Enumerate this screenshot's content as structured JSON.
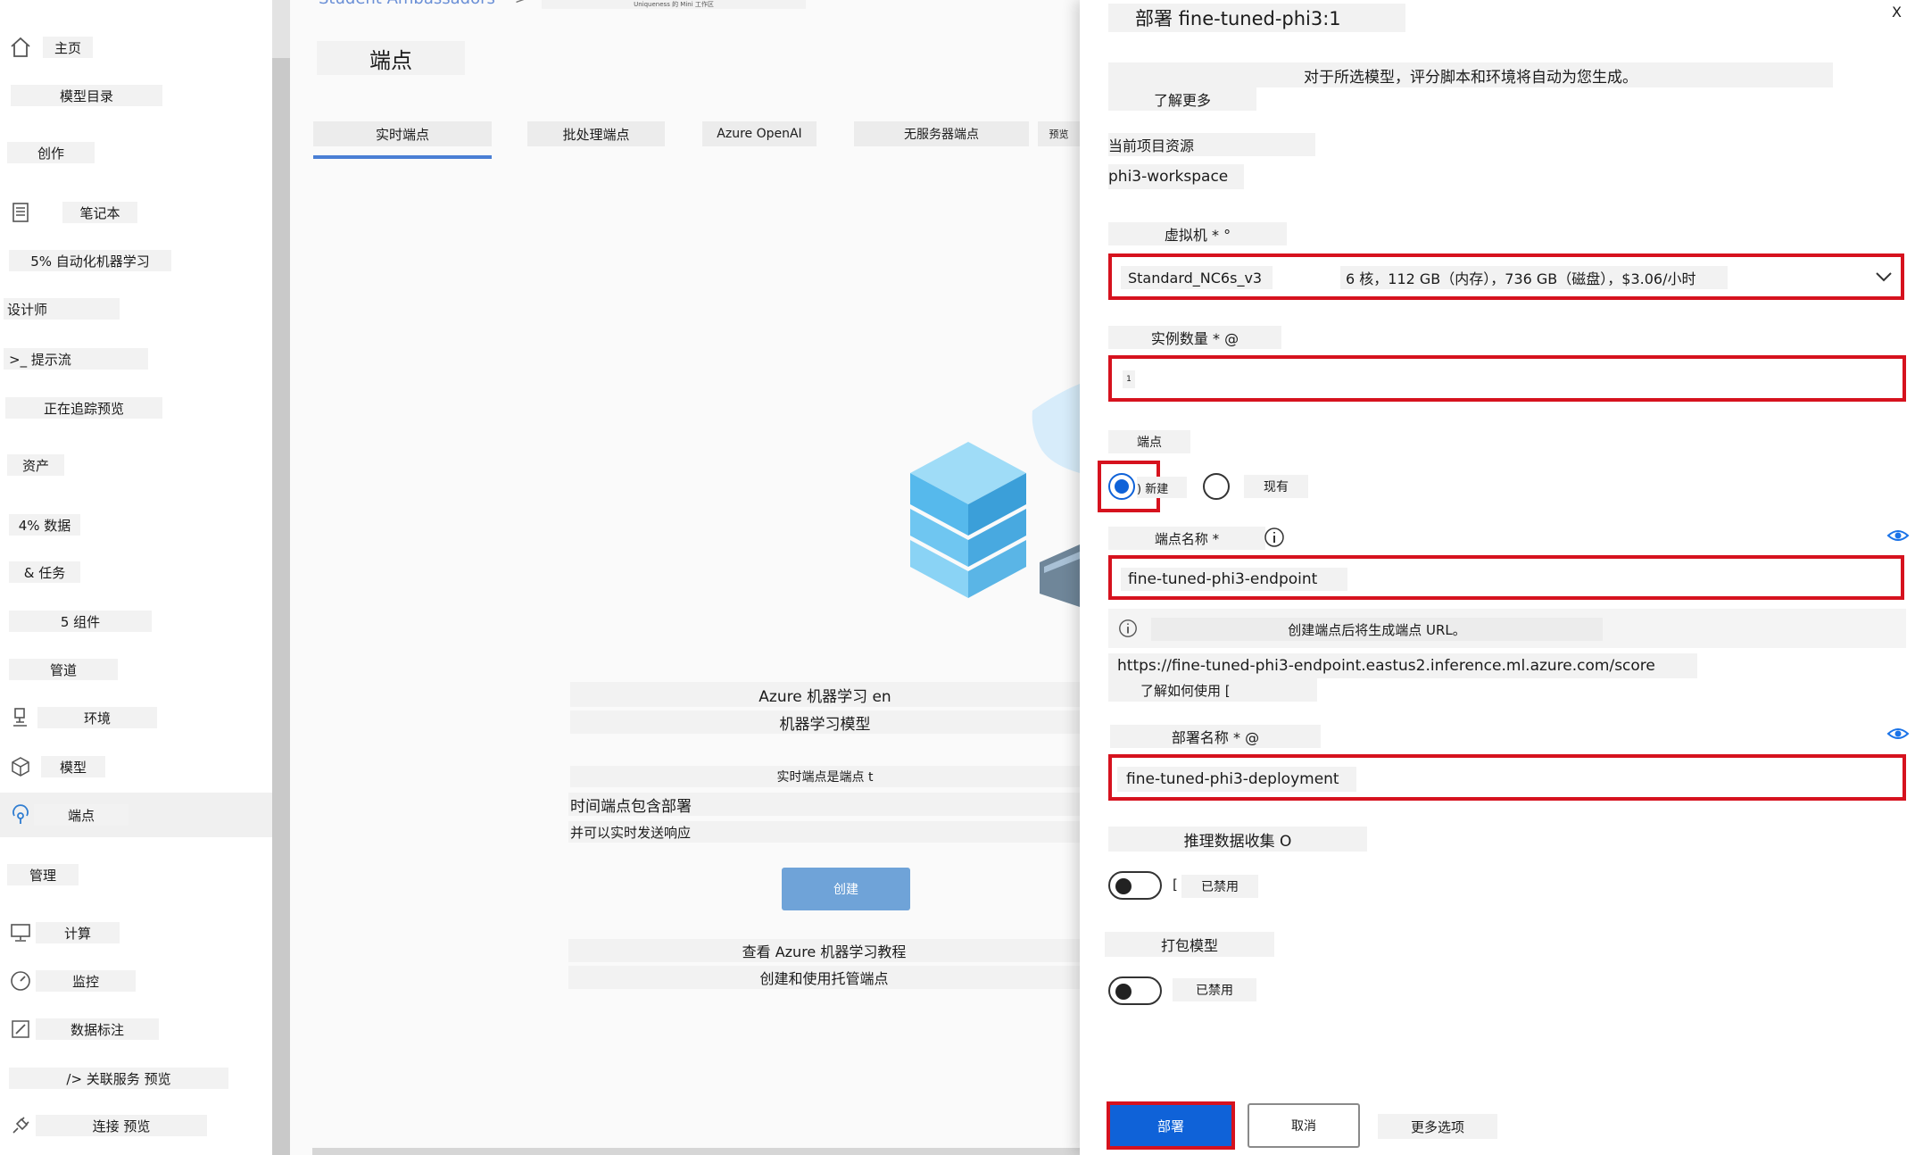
{
  "sidebar": {
    "items": [
      {
        "label": "主页",
        "icon": "home-icon"
      },
      {
        "label": "模型目录",
        "icon": ""
      },
      {
        "label": "创作",
        "icon": ""
      },
      {
        "label": "笔记本",
        "icon": "notebook-icon"
      },
      {
        "label": "5% 自动化机器学习",
        "icon": ""
      },
      {
        "label": "设计师",
        "icon": ""
      },
      {
        "label": ">_ 提示流",
        "icon": ""
      },
      {
        "label": "正在追踪预览",
        "icon": ""
      },
      {
        "label": "资产",
        "icon": ""
      },
      {
        "label": "4% 数据",
        "icon": ""
      },
      {
        "label": "& 任务",
        "icon": ""
      },
      {
        "label": "5 组件",
        "icon": ""
      },
      {
        "label": "管道",
        "icon": ""
      },
      {
        "label": "环境",
        "icon": "environment-icon"
      },
      {
        "label": "模型",
        "icon": "cube-icon"
      },
      {
        "label": "端点",
        "icon": "endpoint-icon"
      },
      {
        "label": "管理",
        "icon": ""
      },
      {
        "label": "计算",
        "icon": "monitor-icon"
      },
      {
        "label": "监控",
        "icon": "gauge-icon"
      },
      {
        "label": "数据标注",
        "icon": "edit-icon"
      },
      {
        "label": "/> 关联服务 预览",
        "icon": ""
      },
      {
        "label": "连接 预览",
        "icon": "plug-icon"
      }
    ]
  },
  "main": {
    "breadcrumb": "Student Ambassadors",
    "breadcrumb_sep": ">",
    "breadcrumb_tail": "Uniqueness 的 Mini 工作区",
    "title": "端点",
    "tabs": [
      "实时端点",
      "批处理端点",
      "Azure OpenAI",
      "无服务器端点",
      "预览"
    ],
    "empty": {
      "heading_1": "Azure 机器学习 en",
      "heading_2": "机器学习模型",
      "desc_1": "实时端点是端点 t",
      "desc_2": "时间端点包含部署",
      "desc_3": "并可以实时发送响应",
      "create_label": "创建",
      "link_1": "查看 Azure 机器学习教程",
      "link_2": "创建和使用托管端点"
    }
  },
  "panel": {
    "title": "部署 fine-tuned-phi3:1",
    "close": "X",
    "intro": "对于所选模型，评分脚本和环境将自动为您生成。",
    "learn_more": "了解更多",
    "current_resource_label": "当前项目资源",
    "current_resource_value": "phi3-workspace",
    "vm_label": "虚拟机 * °",
    "vm_name": "Standard_NC6s_v3",
    "vm_spec": "6 核，112 GB（内存），736 GB（磁盘），$3.06/小时",
    "instance_label": "实例数量 * @",
    "instance_value": "1",
    "endpoint_label": "端点",
    "endpoint_new": ") 新建",
    "endpoint_existing": "现有",
    "endpoint_name_label": "端点名称 *",
    "endpoint_name_value": "fine-tuned-phi3-endpoint",
    "url_info": "创建端点后将生成端点 URL。",
    "url_value": "https://fine-tuned-phi3-endpoint.eastus2.inference.ml.azure.com/score",
    "url_howto": "了解如何使用 [",
    "deployment_name_label": "部署名称 * @",
    "deployment_name_value": "fine-tuned-phi3-deployment",
    "inference_label": "推理数据收集 O",
    "inference_bracket": "[",
    "inference_state": "已禁用",
    "package_label": "打包模型",
    "package_state": "已禁用",
    "deploy_btn": "部署",
    "cancel_btn": "取消",
    "more_btn": "更多选项"
  },
  "colors": {
    "primary": "#0f62d8",
    "highlight_red": "#d6121e",
    "create_button": "#6fa3d8",
    "eye_icon": "#1a73e8"
  }
}
